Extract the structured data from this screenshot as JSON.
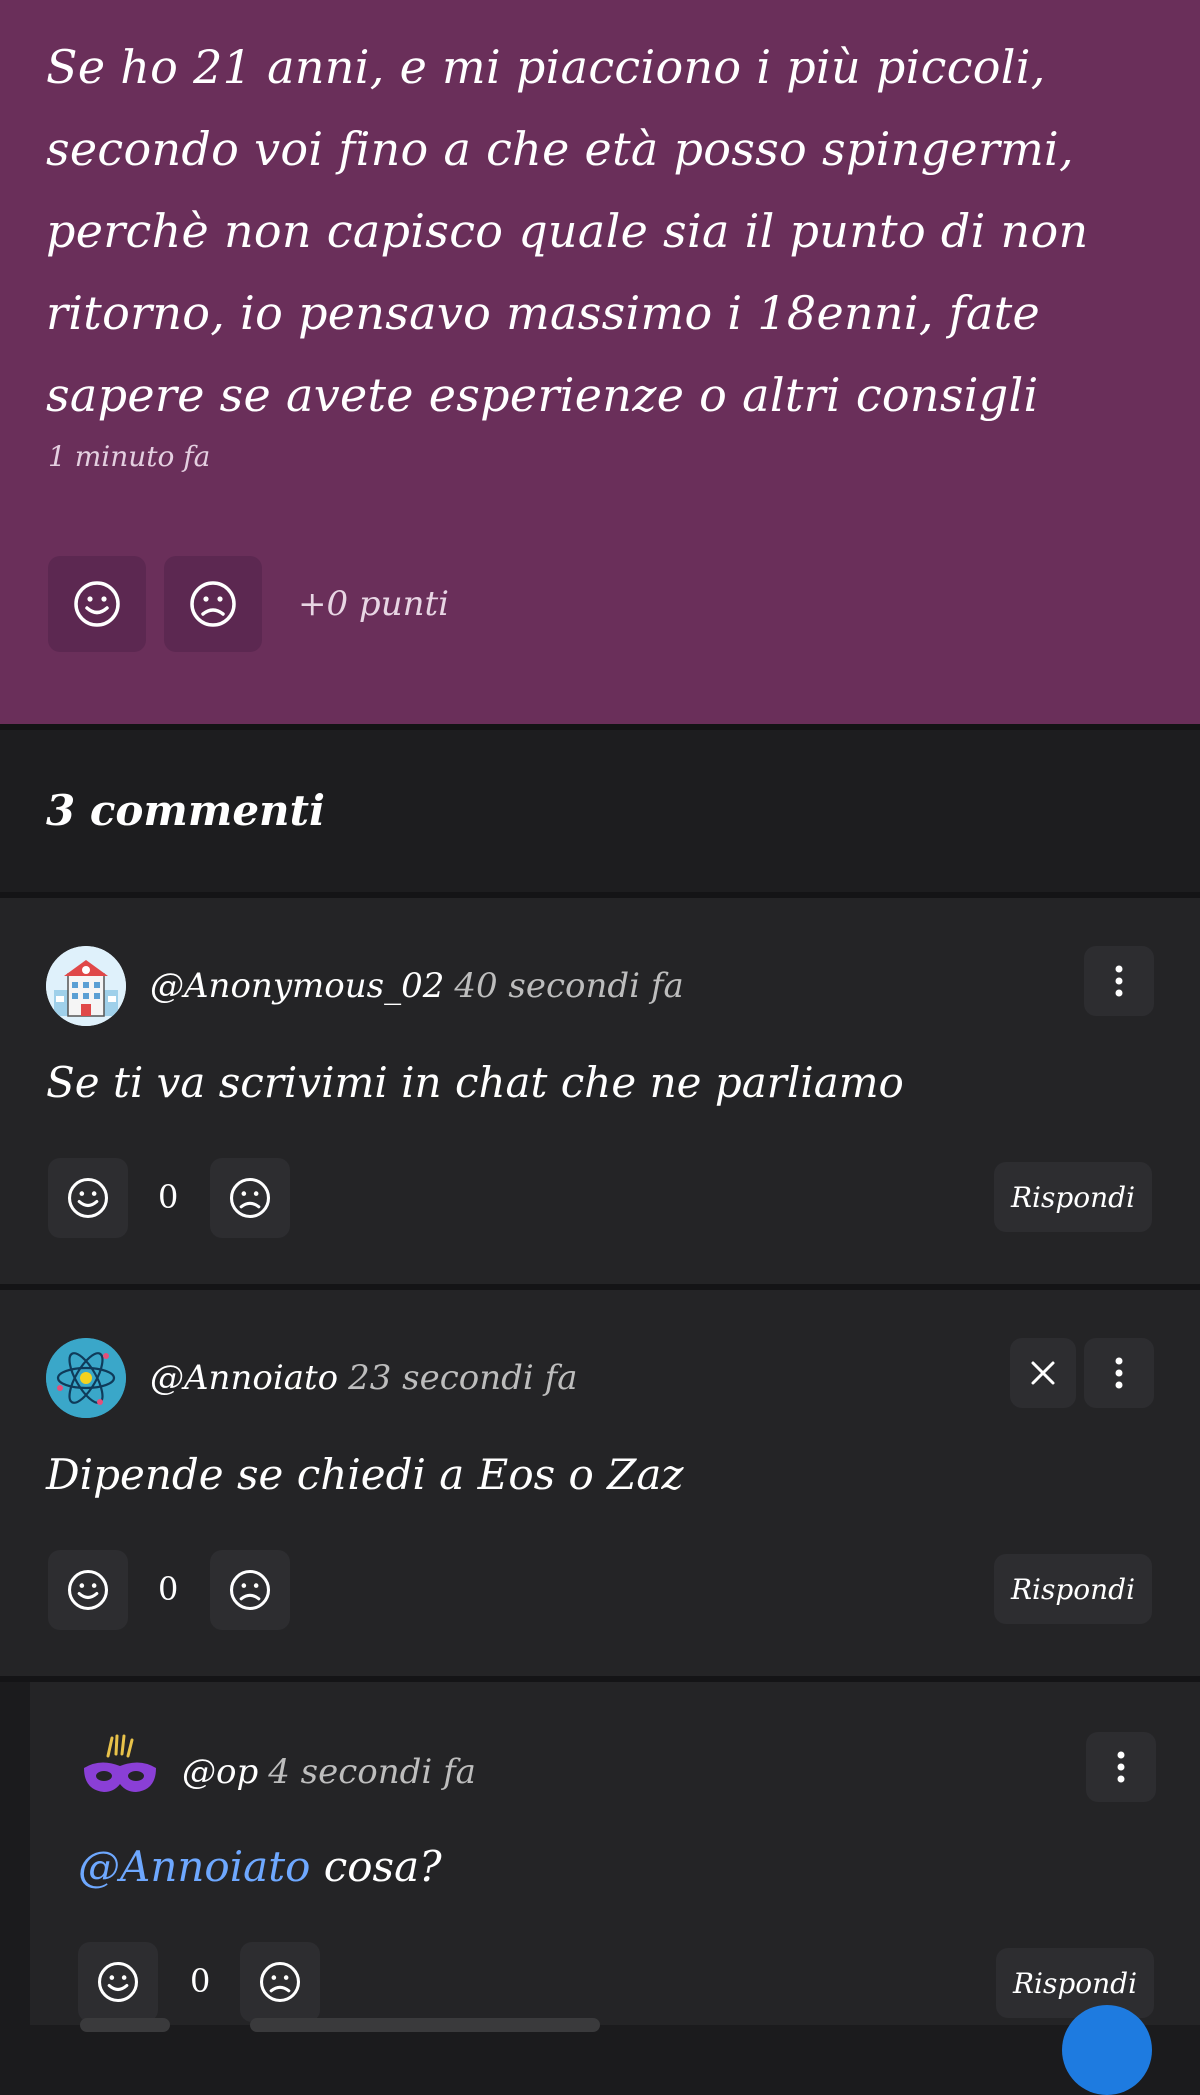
{
  "post": {
    "text": "Se ho 21 anni, e mi piacciono i più piccoli, secondo voi fino a che età posso spingermi, perchè non capisco quale sia il punto di non ritorno, io pensavo massimo i 18enni, fate sapere se avete esperienze o altri consigli",
    "time": "1 minuto fa",
    "points": "+0 punti",
    "background": "#6a2f5a"
  },
  "comments_header": {
    "count_label": "3 commenti"
  },
  "comments": [
    {
      "username": "@Anonymous_02",
      "time": "40 secondi fa",
      "text": "Se ti va scrivimi in chat che ne parliamo",
      "votes": "0",
      "reply_label": "Rispondi",
      "avatar_icon": "school-building-icon"
    },
    {
      "username": "@Annoiato",
      "time": "23 secondi fa",
      "text": "Dipende se chiedi a Eos o Zaz",
      "votes": "0",
      "reply_label": "Rispondi",
      "avatar_icon": "atom-icon"
    },
    {
      "username": "@op",
      "time": "4 secondi fa",
      "mention": "@Annoiato",
      "text": " cosa?",
      "votes": "0",
      "reply_label": "Rispondi",
      "avatar_icon": "carnival-mask-icon"
    }
  ],
  "colors": {
    "accent_mention": "#6ea8ff",
    "fab": "#1e7be0"
  }
}
